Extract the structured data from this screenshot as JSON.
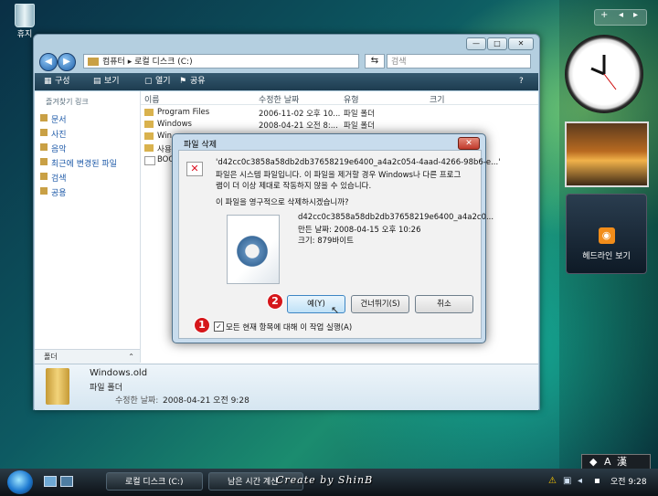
{
  "desktop": {
    "recycle_label": "휴지",
    "watermark": "Create by ShinB",
    "feed_label": "헤드라인 보기"
  },
  "explorer": {
    "address": {
      "segments": [
        "컴퓨터",
        "로컬 디스크 (C:)"
      ],
      "sep": "▸"
    },
    "search_placeholder": "검색",
    "toolbar": {
      "organize": "구성",
      "views": "보기",
      "open": "열기",
      "share": "공유"
    },
    "left_pane": {
      "header": "즐겨찾기 링크",
      "links": [
        "문서",
        "사진",
        "음악",
        "최근에 변경된 파일",
        "검색",
        "공용"
      ],
      "folders_label": "폴더"
    },
    "columns": {
      "name": "이름",
      "modified": "수정한 날짜",
      "type": "유형",
      "size": "크기"
    },
    "files": [
      {
        "name": "Program Files",
        "modified": "2006-11-02 오후 10...",
        "type": "파일 폴더"
      },
      {
        "name": "Windows",
        "modified": "2008-04-21 오전 8:...",
        "type": "파일 폴더"
      },
      {
        "name": "Win",
        "modified": "",
        "type": ""
      },
      {
        "name": "사용",
        "modified": "",
        "type": ""
      },
      {
        "name": "BOO",
        "modified": "",
        "type": ""
      }
    ],
    "details": {
      "name": "Windows.old",
      "type": "파일 폴더",
      "modified_label": "수정한 날짜:",
      "modified_value": "2008-04-21 오전 9:28"
    }
  },
  "dialog": {
    "title": "파일 삭제",
    "warning_line1": "'d42cc0c3858a58db2db37658219e6400_a4a2c054-4aad-4266-98b6-e...'",
    "warning_line2": "파일은 시스템 파일입니다. 이 파일을 제거할 경우 Windows나 다른 프로그",
    "warning_line3": "램이 더 이상 제대로 작동하지 않을 수 있습니다.",
    "question": "이 파일을 영구적으로 삭제하시겠습니까?",
    "file_name": "d42cc0c3858a58db2db37658219e6400_a4a2c0...",
    "file_date": "만든 날짜: 2008-04-15 오후 10:26",
    "file_size": "크기: 879바이트",
    "yes_button": "예(Y)",
    "skip_button": "건너뛰기(S)",
    "cancel_button": "취소",
    "checkbox_label": "모든 현재 항목에 대해 이 작업 실행(A)",
    "badge_1": "1",
    "badge_2": "2"
  },
  "taskbar": {
    "tasks": [
      "로컬 디스크 (C:)",
      "남은 시간 계산"
    ],
    "clock": "오전 9:28"
  }
}
